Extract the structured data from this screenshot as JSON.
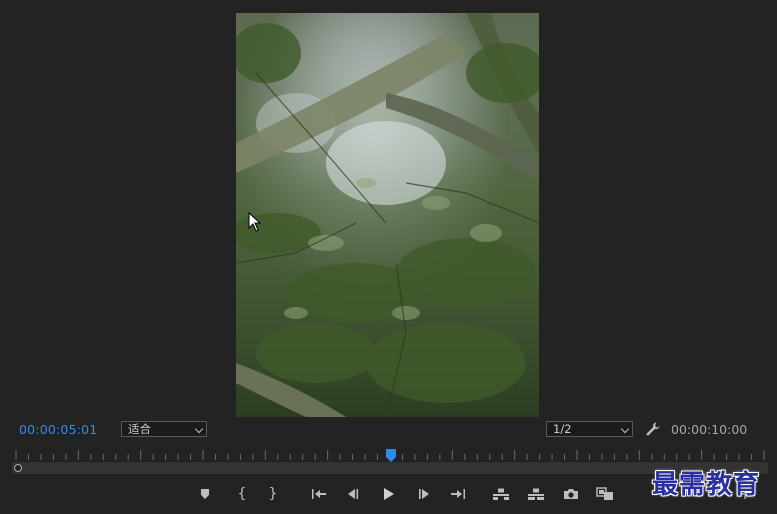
{
  "timecode": {
    "current": "00:00:05:01",
    "duration": "00:00:10:00"
  },
  "zoom_select": {
    "value": "适合"
  },
  "resolution_select": {
    "value": "1/2"
  },
  "playback": {
    "position_fraction": 0.5
  },
  "controls": [
    {
      "name": "add-marker",
      "icon": "marker-icon"
    },
    {
      "name": "mark-in",
      "icon": "mark-in-brace",
      "glyph": "{"
    },
    {
      "name": "mark-out",
      "icon": "mark-out-brace",
      "glyph": "}"
    },
    {
      "name": "go-to-in",
      "icon": "go-to-in-icon"
    },
    {
      "name": "step-back",
      "icon": "step-back-icon"
    },
    {
      "name": "play",
      "icon": "play-icon"
    },
    {
      "name": "step-forward",
      "icon": "step-forward-icon"
    },
    {
      "name": "go-to-out",
      "icon": "go-to-out-icon"
    },
    {
      "name": "lift",
      "icon": "lift-icon"
    },
    {
      "name": "extract",
      "icon": "extract-icon"
    },
    {
      "name": "export-frame",
      "icon": "camera-icon"
    },
    {
      "name": "comparison-view",
      "icon": "comparison-view-icon"
    }
  ],
  "watermark": {
    "text": "最需教育"
  },
  "colors": {
    "accent": "#2d8ceb",
    "background": "#232323",
    "track": "#333333",
    "watermark": "#2a2fa0"
  }
}
